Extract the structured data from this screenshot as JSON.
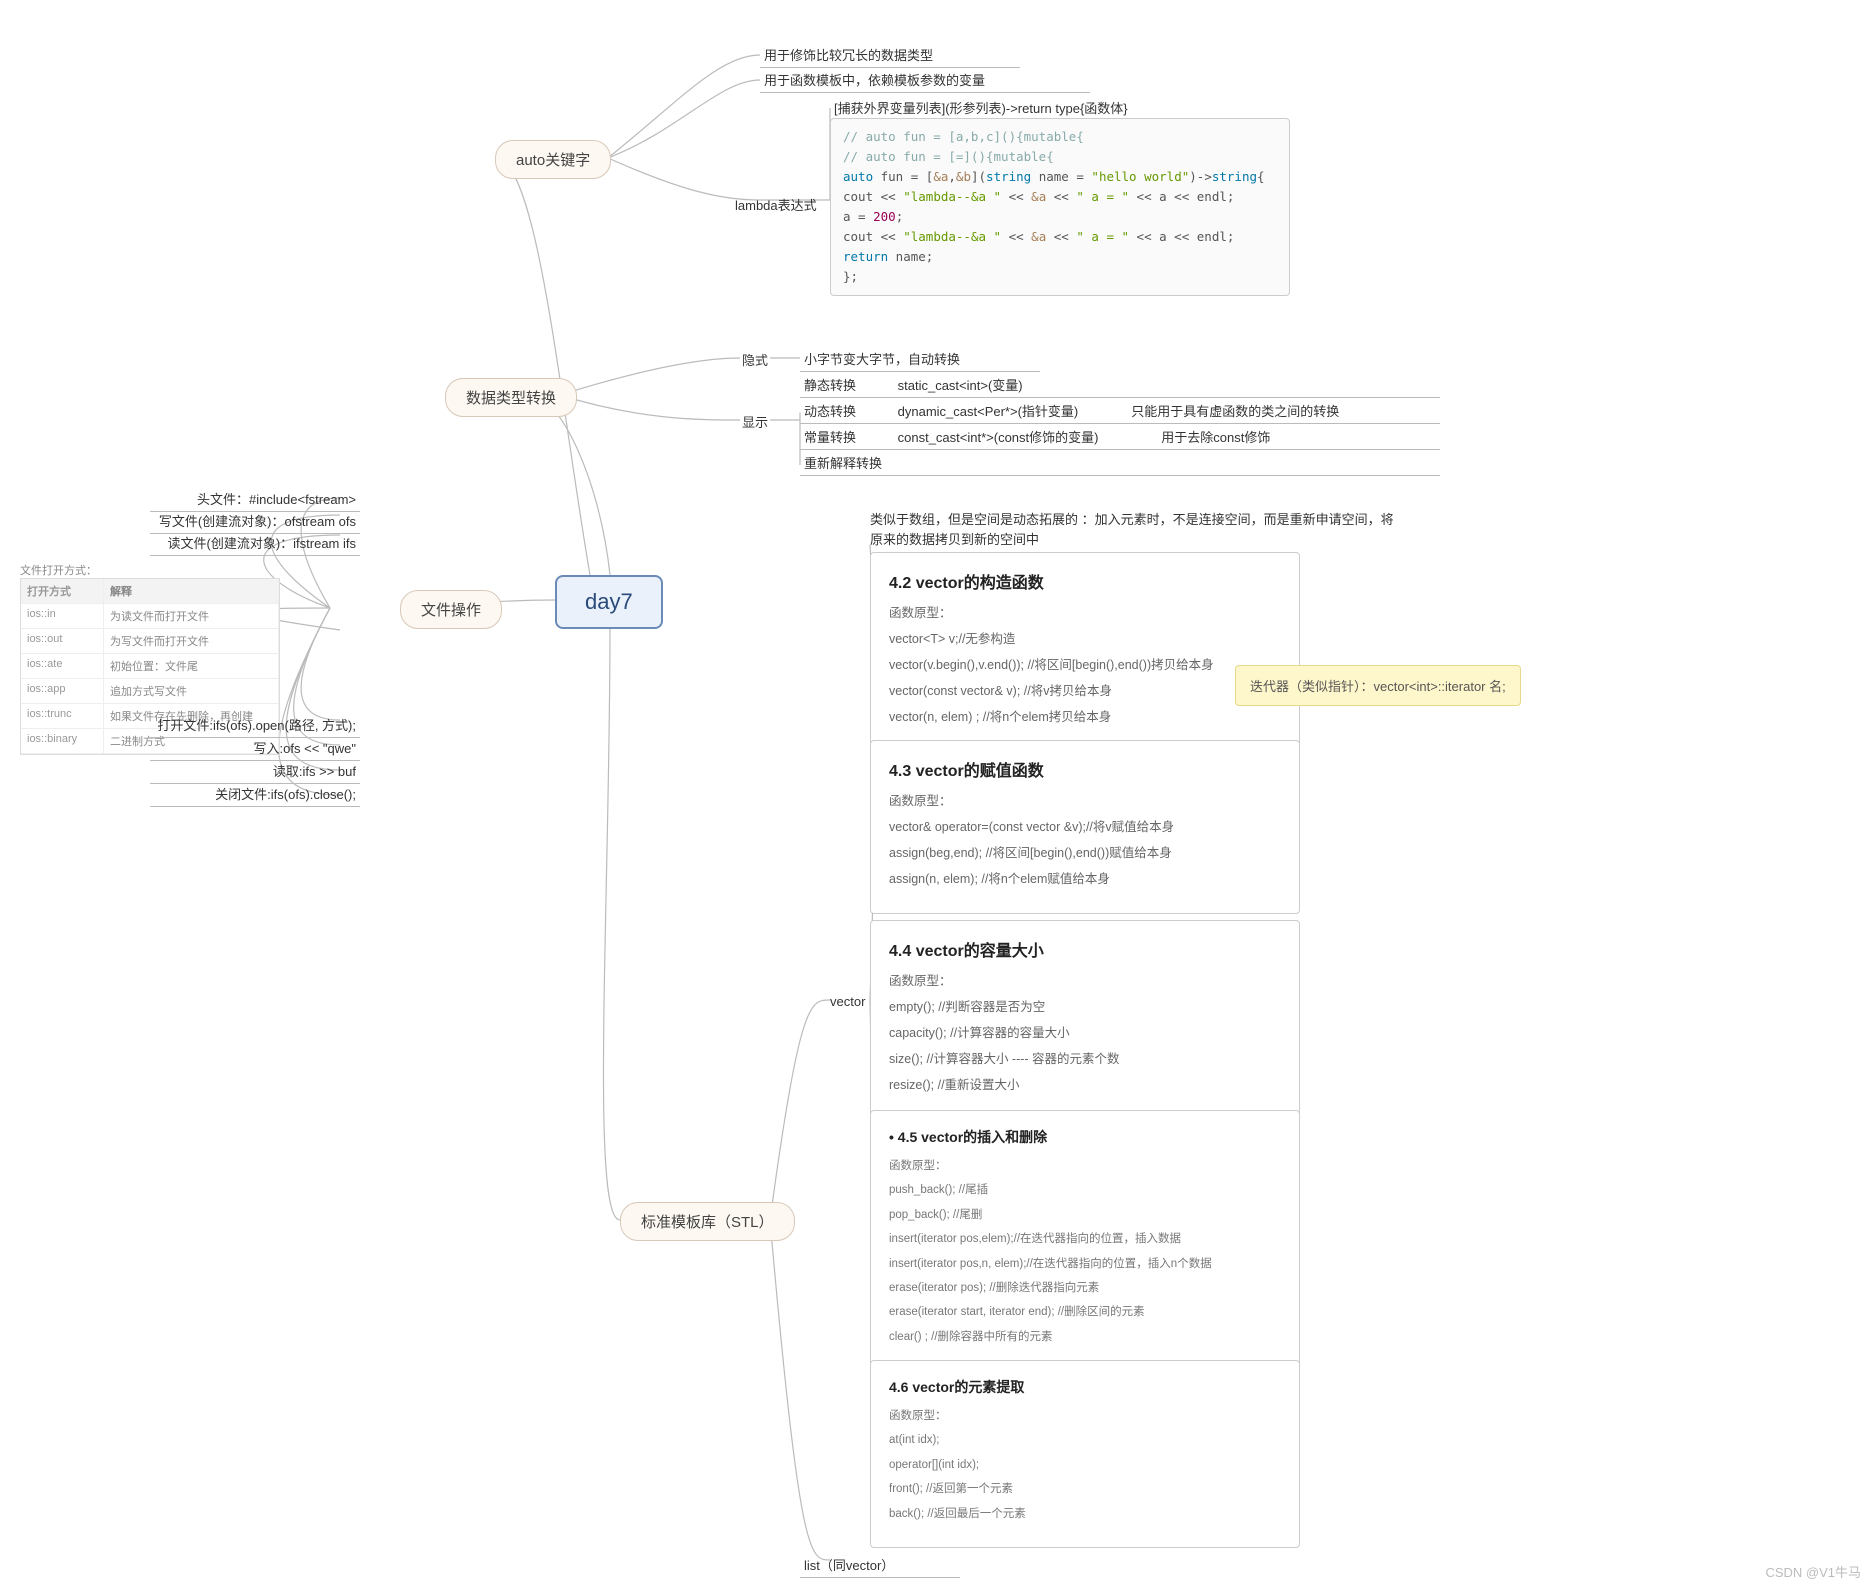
{
  "center": {
    "title": "day7"
  },
  "auto_kw": {
    "label": "auto关键字",
    "line1": "用于修饰比较冗长的数据类型",
    "line2": "用于函数模板中，依赖模板参数的变量",
    "lambda_label": "lambda表达式",
    "lambda_header": "[捕获外界变量列表](形参列表)->return type{函数体}",
    "code": {
      "l1a": "//    auto fun = [a,b,c](){mutable{",
      "l2a": "//    auto fun = [=](){mutable{",
      "l3a": "auto",
      "l3b": " fun = [",
      "l3c": "&a",
      "l3d": ",",
      "l3e": "&b",
      "l3f": "](",
      "l3g": "string",
      "l3h": " name = ",
      "l3i": "\"hello world\"",
      "l3j": ")->",
      "l3k": "string",
      "l3l": "{",
      "l4a": "    cout << ",
      "l4b": "\"lambda--&a \"",
      "l4c": " << ",
      "l4d": "&a",
      "l4e": " << ",
      "l4f": "\" a = \"",
      "l4g": " << a << endl;",
      "l5a": "    a = ",
      "l5b": "200",
      "l5c": ";",
      "l6a": "    cout << ",
      "l6b": "\"lambda--&a \"",
      "l6c": " << ",
      "l6d": "&a",
      "l6e": " << ",
      "l6f": "\" a = \"",
      "l6g": " << a << endl;",
      "l7a": "    return",
      "l7b": " name;",
      "l8": "};"
    }
  },
  "type_conv": {
    "label": "数据类型转换",
    "implicit_label": "隐式",
    "implicit_text": "小字节变大字节，自动转换",
    "explicit_label": "显示",
    "rows": {
      "r1a": "静态转换",
      "r1b": "static_cast<int>(变量)",
      "r2a": "动态转换",
      "r2b": "dynamic_cast<Per*>(指针变量)",
      "r2c": "只能用于具有虚函数的类之间的转换",
      "r3a": "常量转换",
      "r3b": "const_cast<int*>(const修饰的变量)",
      "r3c": "用于去除const修饰",
      "r4a": "重新解释转换"
    }
  },
  "file_ops": {
    "label": "文件操作",
    "header_include": "头文件：#include<fstream>",
    "write_obj": "写文件(创建流对象)：ofstream ofs",
    "read_obj": "读文件(创建流对象)：ifstream ifs",
    "table_title": "文件打开方式：",
    "table_hdr1": "打开方式",
    "table_hdr2": "解释",
    "t": [
      {
        "a": "ios::in",
        "b": "为读文件而打开文件"
      },
      {
        "a": "ios::out",
        "b": "为写文件而打开文件"
      },
      {
        "a": "ios::ate",
        "b": "初始位置：文件尾"
      },
      {
        "a": "ios::app",
        "b": "追加方式写文件"
      },
      {
        "a": "ios::trunc",
        "b": "如果文件存在先删除，再创建"
      },
      {
        "a": "ios::binary",
        "b": "二进制方式"
      }
    ],
    "open": "打开文件:ifs(ofs).open(路径, 方式);",
    "write": "写入:ofs << \"qwe\"",
    "read": "读取:ifs >> buf",
    "close": "关闭文件:ifs(ofs).close();"
  },
  "stl": {
    "label": "标准模板库（STL）",
    "vector_label": "vector",
    "intro": "类似于数组，但是空间是动态拓展的 ：加入元素时，不是连接空间，而是重新申请空间，将原来的数据拷贝到新的空间中",
    "callout": "迭代器（类似指针）：vector<int>::iterator 名;",
    "c42": {
      "title": "4.2 vector的构造函数",
      "p0": "函数原型：",
      "p1": "vector<T> v;//无参构造",
      "p2": "vector(v.begin(),v.end()); //将区间[begin(),end())拷贝给本身",
      "p3": "vector(const vector& v); //将v拷贝给本身",
      "p4": "vector(n, elem) ; //将n个elem拷贝给本身"
    },
    "c43": {
      "title": "4.3 vector的赋值函数",
      "p0": "函数原型：",
      "p1": "vector& operator=(const vector &v);//将v赋值给本身",
      "p2": "assign(beg,end); //将区间[begin(),end())赋值给本身",
      "p3": "assign(n, elem); //将n个elem赋值给本身"
    },
    "c44": {
      "title": "4.4 vector的容量大小",
      "p0": "函数原型：",
      "p1": "empty(); //判断容器是否为空",
      "p2": "capacity(); //计算容器的容量大小",
      "p3": "size(); //计算容器大小 ---- 容器的元素个数",
      "p4": "resize(); //重新设置大小"
    },
    "c45": {
      "title": "4.5 vector的插入和删除",
      "p0": "函数原型：",
      "p1": "push_back(); //尾插",
      "p2": "pop_back(); //尾删",
      "p3": "insert(iterator pos,elem);//在迭代器指向的位置，插入数据",
      "p4": "insert(iterator pos,n, elem);//在迭代器指向的位置，插入n个数据",
      "p5": "erase(iterator pos); //删除迭代器指向元素",
      "p6": "erase(iterator start, iterator end); //删除区间的元素",
      "p7": "clear() ; //删除容器中所有的元素"
    },
    "c46": {
      "title": "4.6 vector的元素提取",
      "p0": "函数原型：",
      "p1": "at(int idx);",
      "p2": "operator[](int idx);",
      "p3": "front(); //返回第一个元素",
      "p4": "back(); //返回最后一个元素"
    },
    "list_label": "list（同vector）"
  },
  "watermark": "CSDN @V1牛马"
}
